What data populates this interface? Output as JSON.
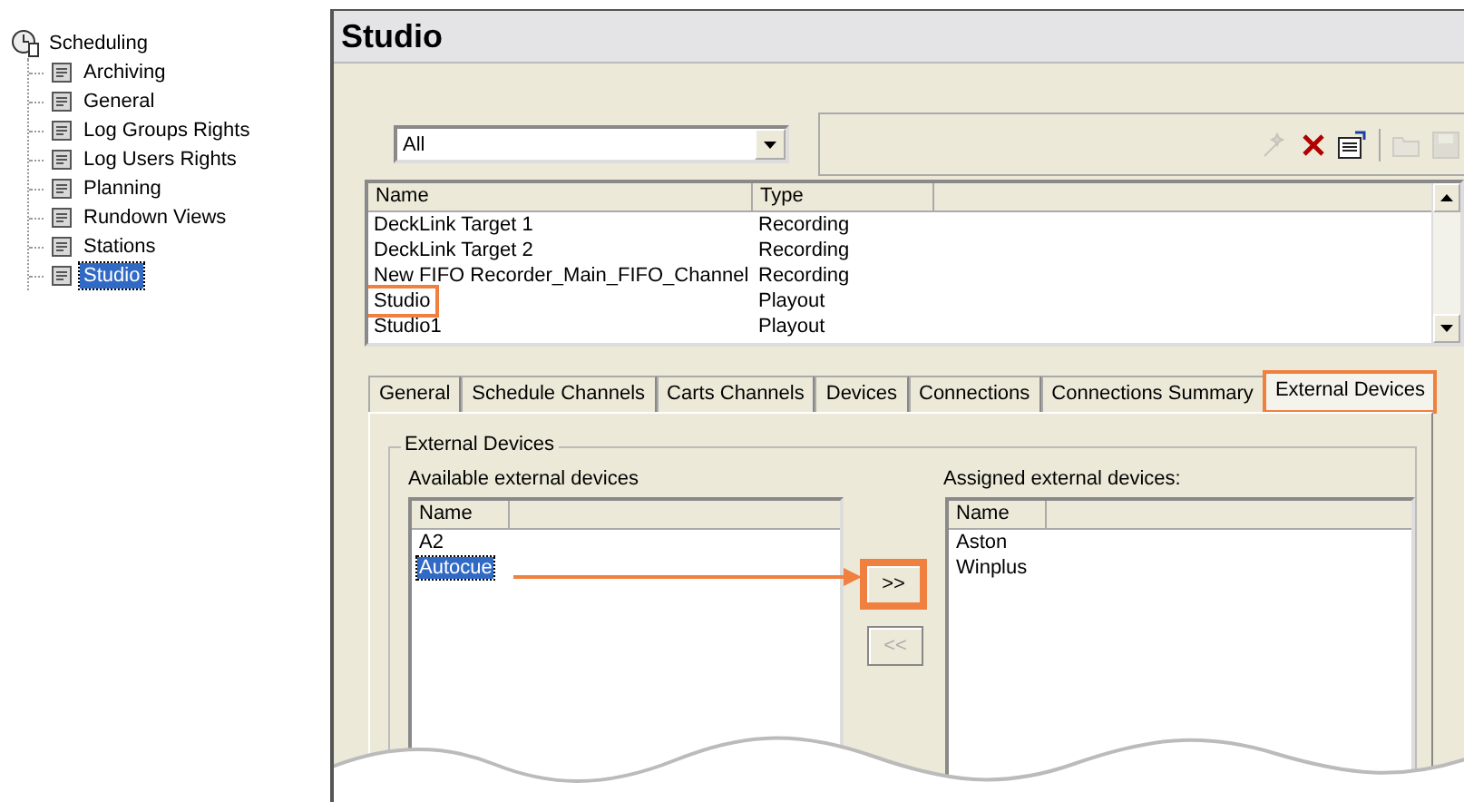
{
  "tree": {
    "label": "Scheduling",
    "children": [
      {
        "label": "Archiving",
        "selected": false
      },
      {
        "label": "General",
        "selected": false
      },
      {
        "label": "Log Groups Rights",
        "selected": false
      },
      {
        "label": "Log Users Rights",
        "selected": false
      },
      {
        "label": "Planning",
        "selected": false
      },
      {
        "label": "Rundown Views",
        "selected": false
      },
      {
        "label": "Stations",
        "selected": false
      },
      {
        "label": "Studio",
        "selected": true
      }
    ]
  },
  "window": {
    "title": "Studio"
  },
  "filter": {
    "value": "All"
  },
  "toolbar": {
    "buttons": [
      {
        "kind": "wand",
        "disabled": true
      },
      {
        "kind": "delete",
        "disabled": false
      },
      {
        "kind": "properties",
        "disabled": false
      },
      {
        "kind": "open",
        "disabled": true
      },
      {
        "kind": "save",
        "disabled": true
      }
    ]
  },
  "channel_list": {
    "columns": [
      "Name",
      "Type"
    ],
    "rows": [
      {
        "name": "DeckLink Target 1",
        "type": "Recording",
        "callout": false
      },
      {
        "name": "DeckLink Target 2",
        "type": "Recording",
        "callout": false
      },
      {
        "name": "New FIFO Recorder_Main_FIFO_Channel",
        "type": "Recording",
        "callout": false
      },
      {
        "name": "Studio",
        "type": "Playout",
        "callout": true
      },
      {
        "name": "Studio1",
        "type": "Playout",
        "callout": false
      }
    ]
  },
  "tabs": [
    {
      "label": "General",
      "selected": false,
      "callout": false
    },
    {
      "label": "Schedule Channels",
      "selected": false,
      "callout": false
    },
    {
      "label": "Carts Channels",
      "selected": false,
      "callout": false
    },
    {
      "label": "Devices",
      "selected": false,
      "callout": false
    },
    {
      "label": "Connections",
      "selected": false,
      "callout": false
    },
    {
      "label": "Connections Summary",
      "selected": false,
      "callout": false
    },
    {
      "label": "External Devices",
      "selected": true,
      "callout": true
    }
  ],
  "external_devices": {
    "group_title": "External Devices",
    "available": {
      "label": "Available external devices",
      "column": "Name",
      "items": [
        {
          "label": "A2",
          "selected": false
        },
        {
          "label": "Autocue",
          "selected": true
        }
      ]
    },
    "assigned": {
      "label": "Assigned external devices:",
      "column": "Name",
      "items": [
        {
          "label": "Aston",
          "selected": false
        },
        {
          "label": "Winplus",
          "selected": false
        }
      ]
    },
    "buttons": [
      {
        "label": ">>",
        "disabled": false,
        "callout": true
      },
      {
        "label": "<<",
        "disabled": true,
        "callout": false
      }
    ]
  }
}
